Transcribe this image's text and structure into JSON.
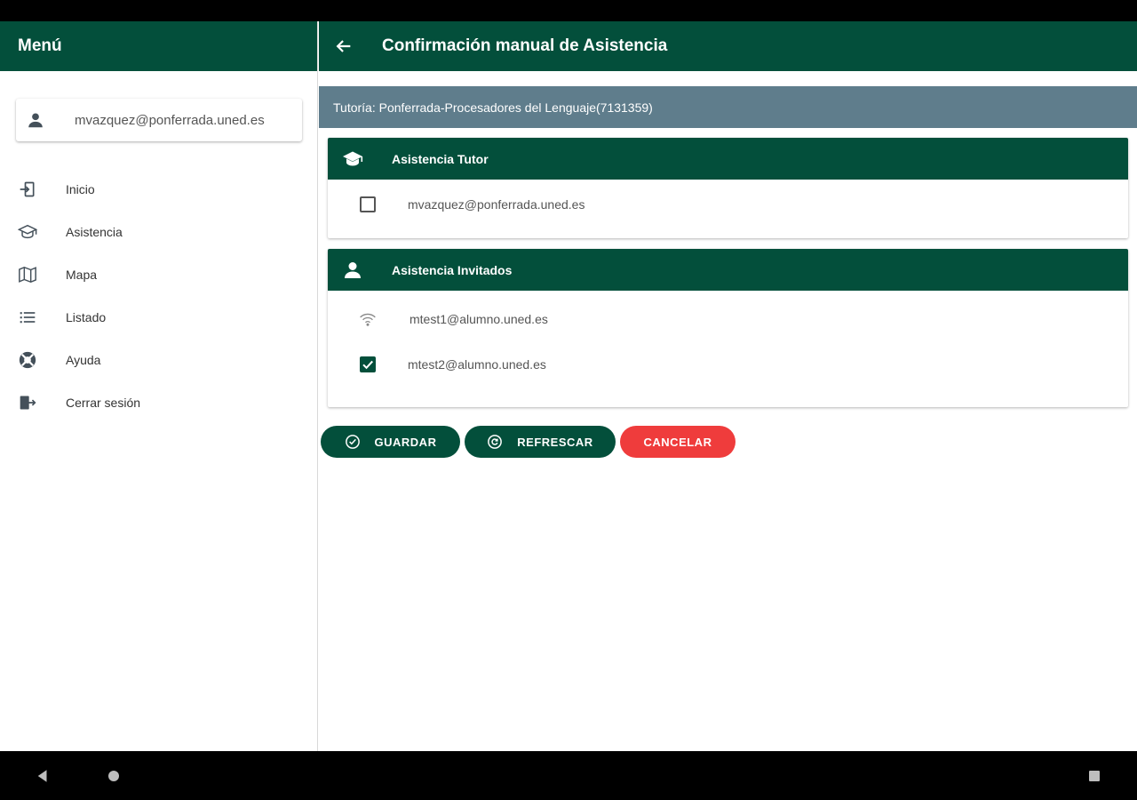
{
  "menu": {
    "title": "Menú",
    "user_email": "mvazquez@ponferrada.uned.es",
    "items": [
      {
        "label": "Inicio",
        "icon": "login-icon"
      },
      {
        "label": "Asistencia",
        "icon": "school-icon"
      },
      {
        "label": "Mapa",
        "icon": "map-icon"
      },
      {
        "label": "Listado",
        "icon": "list-icon"
      },
      {
        "label": "Ayuda",
        "icon": "help-lifebuoy-icon"
      },
      {
        "label": "Cerrar sesión",
        "icon": "logout-icon"
      }
    ]
  },
  "toolbar": {
    "title": "Confirmación manual de Asistencia"
  },
  "tutoria": "Tutoría: Ponferrada-Procesadores del Lenguaje(7131359)",
  "tutor_section": {
    "title": "Asistencia Tutor",
    "rows": [
      {
        "email": "mvazquez@ponferrada.uned.es",
        "checked": false
      }
    ]
  },
  "invitados_section": {
    "title": "Asistencia Invitados",
    "rows": [
      {
        "email": "mtest1@alumno.uned.es",
        "status": "wifi-icon"
      },
      {
        "email": "mtest2@alumno.uned.es",
        "checked": true
      }
    ]
  },
  "actions": {
    "guardar": "GUARDAR",
    "refrescar": "REFRESCAR",
    "cancelar": "CANCELAR"
  },
  "colors": {
    "primary": "#034f3b",
    "subheader": "#5f7d8c",
    "danger": "#ef3c3c"
  }
}
